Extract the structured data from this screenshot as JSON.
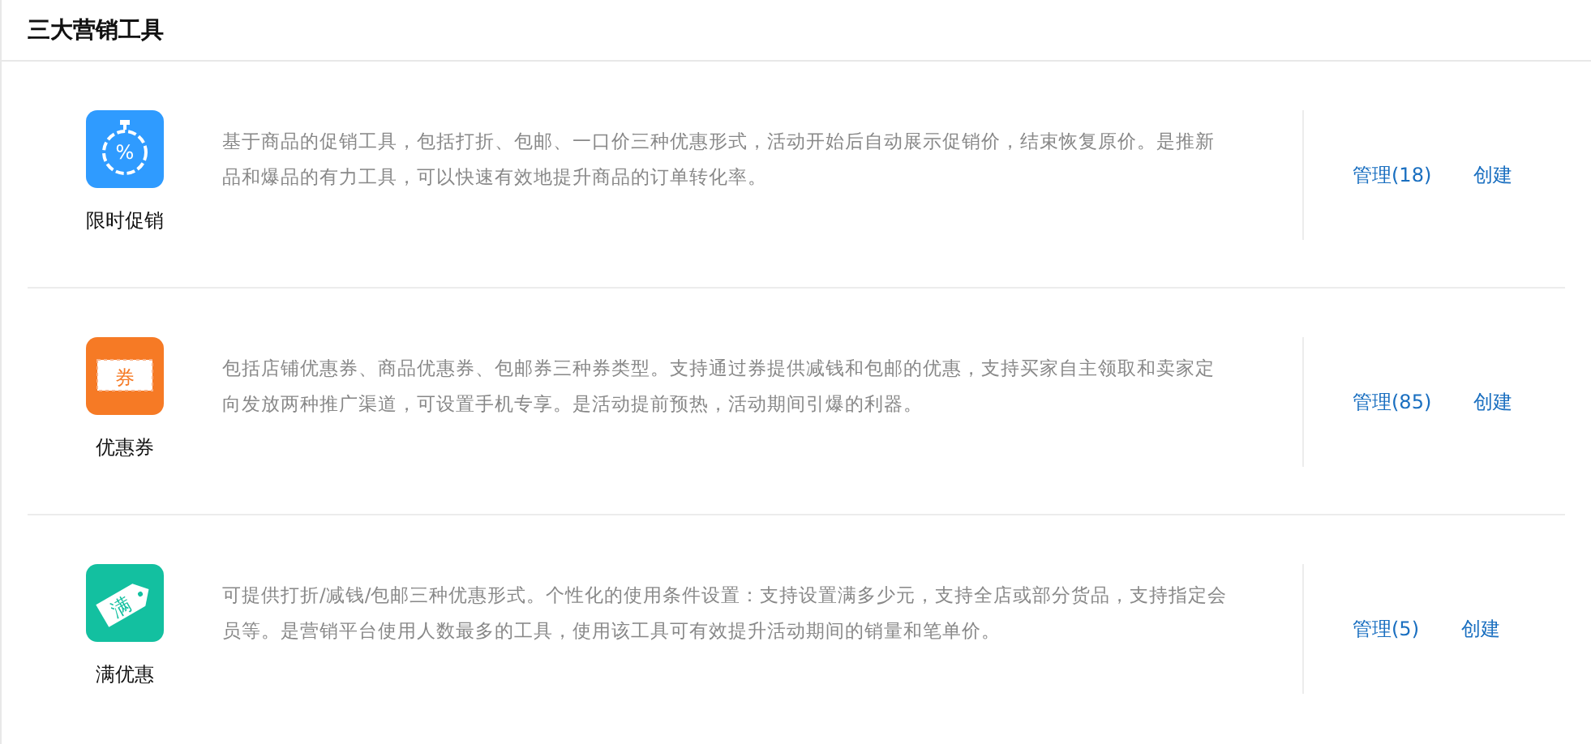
{
  "title": "三大营销工具",
  "tools": [
    {
      "name": "限时促销",
      "icon": {
        "kind": "stopwatch",
        "glyph": "%",
        "color": "#2f9bff"
      },
      "description": "基于商品的促销工具，包括打折、包邮、一口价三种优惠形式，活动开始后自动展示促销价，结束恢复原价。是推新品和爆品的有力工具，可以快速有效地提升商品的订单转化率。",
      "manage": "管理(18)",
      "create": "创建"
    },
    {
      "name": "优惠券",
      "icon": {
        "kind": "ticket",
        "glyph": "券",
        "color": "#f67a25"
      },
      "description": "包括店铺优惠券、商品优惠券、包邮券三种券类型。支持通过券提供减钱和包邮的优惠，支持买家自主领取和卖家定向发放两种推广渠道，可设置手机专享。是活动提前预热，活动期间引爆的利器。",
      "manage": "管理(85)",
      "create": "创建"
    },
    {
      "name": "满优惠",
      "icon": {
        "kind": "tag",
        "glyph": "满",
        "color": "#13c0a0"
      },
      "description": "可提供打折/减钱/包邮三种优惠形式。个性化的使用条件设置：支持设置满多少元，支持全店或部分货品，支持指定会员等。是营销平台使用人数最多的工具，使用该工具可有效提升活动期间的销量和笔单价。",
      "manage": "管理(5)",
      "create": "创建"
    }
  ]
}
